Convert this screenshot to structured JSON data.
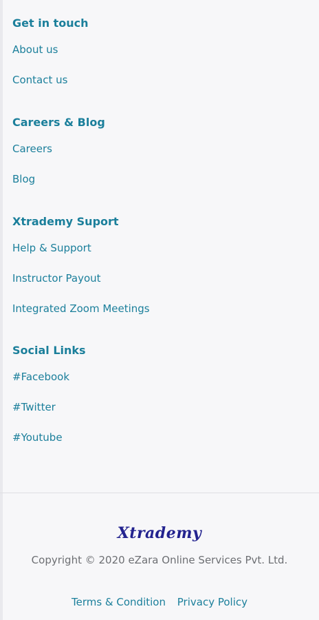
{
  "sections": [
    {
      "title": "Get in touch",
      "links": [
        "About us",
        "Contact us"
      ]
    },
    {
      "title": "Careers & Blog",
      "links": [
        "Careers",
        "Blog"
      ]
    },
    {
      "title": "Xtrademy Suport",
      "links": [
        "Help & Support",
        "Instructor Payout",
        "Integrated Zoom Meetings"
      ]
    },
    {
      "title": "Social Links",
      "links": [
        "#Facebook",
        "#Twitter",
        "#Youtube"
      ]
    }
  ],
  "footer": {
    "logo": "Xtrademy",
    "copyright": "Copyright © 2020 eZara Online Services Pvt. Ltd.",
    "terms": "Terms & Condition",
    "privacy": "Privacy Policy"
  },
  "colors": {
    "link": "#1b7f9b",
    "logo": "#23238f",
    "muted_text": "#6d6f73",
    "background": "#f7f7f9"
  }
}
